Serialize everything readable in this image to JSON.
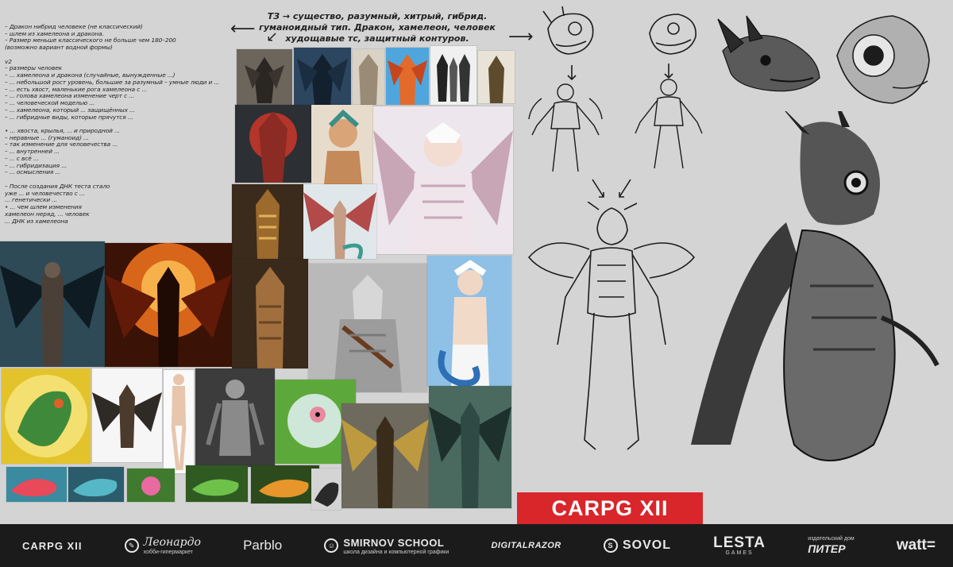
{
  "notes": {
    "left": "– Дракон нибрид человеке (не классический)\n– шлем из хамелеона и дракона.\n– Размер меньше классического не больше чем 180–200\n  (возможно вариант водной формы)\n\nv2\n– размеры человек\n– ... хамелеона и дракона (случайные, вынужденные ...)\n– ... небольшой рост уровень, большие за разумный – умные люди и ...\n– ... есть хвост, маленькие рога хамелеона с ...\n– ... голова хамелеона изменение черт с ...\n– ... человеческой моделью ...\n– ... хамелеона, который ... защищённых ...\n– ... гибридные виды, которые прячутся ...\n\n• ... хвоста, крылья, ... и природной ...\n– неравные ... (гуманоид) ...\n– так изменение для человечества ...\n– ... внутренней ...\n– ... с всё ...\n– ... гибридизация ...\n– ... осмысления ...\n\n– После создания ДНК теста стало\n  уже ... и человечество с ...\n  ... генетически ...\n• ... чем шлем изменения\n  хамелеон неряд, ... человек\n  ... ДНК из хамелеона",
    "top": "ТЗ → существо, разумный, хитрый, гибрид.\nгуманоидный тип. Дракон, хамелеон, человек\nхудощавые тс, защитный контуров."
  },
  "banner": {
    "title": "CARPG XII"
  },
  "sponsors": {
    "carpg": "CARPG XII",
    "leonardo": "Леонардо",
    "leonardo_sub": "хобби-гипермаркет",
    "parblo": "Parblo",
    "smirnov": "SMIRNOV SCHOOL",
    "smirnov_sub": "школа дизайна и компьютерной графики",
    "digital": "DIGITALRAZOR",
    "sovol": "SOVOL",
    "lesta": "LESTA",
    "lesta_sub": "GAMES",
    "piter_sub": "издательский дом",
    "piter": "ПИТЕР",
    "watt": "watt="
  },
  "icons": {
    "leonardo": "leonardo-logo-icon",
    "smirnov": "smirnov-school-logo-icon",
    "sovol": "sovol-logo-icon"
  },
  "colors": {
    "board": "#d4d4d4",
    "banner": "#d8262a",
    "sponsor_bar": "#1b1b1b"
  }
}
